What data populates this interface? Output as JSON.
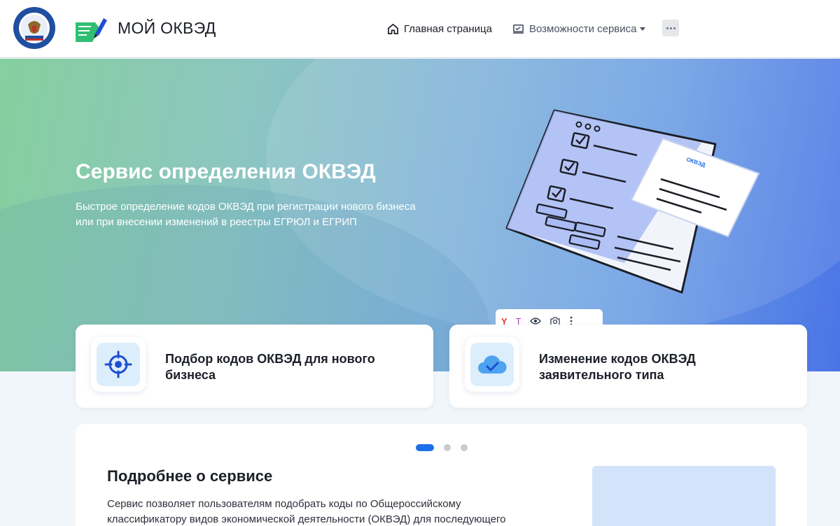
{
  "header": {
    "app_title": "МОЙ ОКВЭД",
    "nav": {
      "home_label": "Главная страница",
      "features_label": "Возможности сервиса"
    }
  },
  "hero": {
    "title": "Сервис определения ОКВЭД",
    "subtitle": "Быстрое определение кодов ОКВЭД при регистрации нового бизнеса или при внесении изменений в реестры ЕГРЮЛ и ЕГРИП",
    "illustration_card_label": "ОКВЭД"
  },
  "cards": [
    {
      "title": "Подбор кодов ОКВЭД для нового бизнеса",
      "icon": "target-icon"
    },
    {
      "title": "Изменение кодов ОКВЭД заявительного типа",
      "icon": "cloud-check-icon"
    }
  ],
  "info": {
    "title": "Подробнее о сервисе",
    "text": "Сервис позволяет пользователям подобрать коды по Общероссийскому классификатору видов экономической деятельности (ОКВЭД) для последующего",
    "carousel": {
      "total": 3,
      "active": 1
    }
  },
  "colors": {
    "accent": "#1d6fe8",
    "hero_start": "#86cf9e",
    "hero_end": "#4a74e6"
  }
}
